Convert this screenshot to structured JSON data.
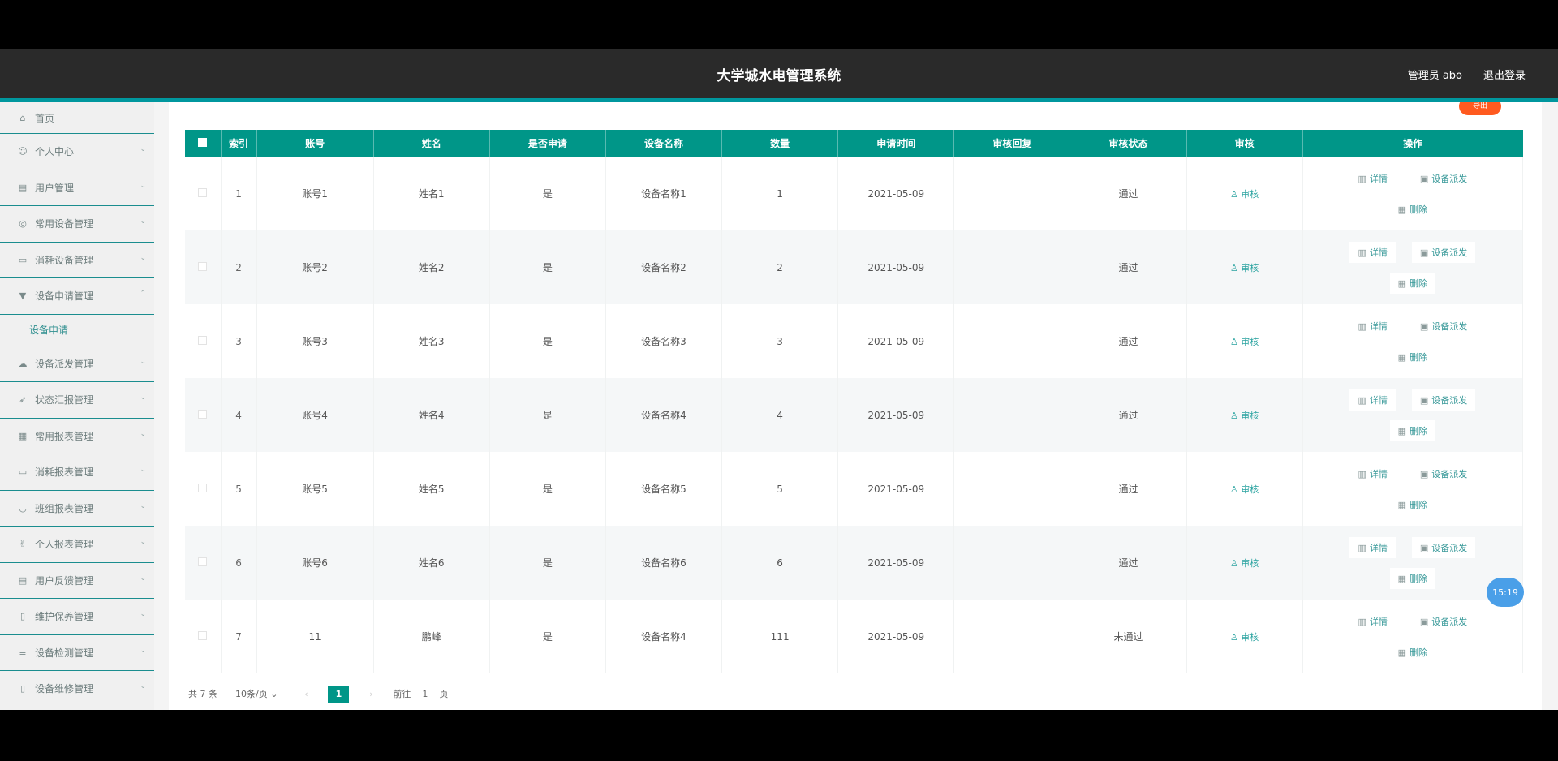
{
  "header": {
    "title": "大学城水电管理系统",
    "user": "管理员 abo",
    "logout": "退出登录"
  },
  "sidebar": {
    "items": [
      {
        "label": "首页",
        "icon": "home-icon"
      },
      {
        "label": "个人中心",
        "icon": "user-icon"
      },
      {
        "label": "用户管理",
        "icon": "users-icon"
      },
      {
        "label": "常用设备管理",
        "icon": "device-icon"
      },
      {
        "label": "消耗设备管理",
        "icon": "consumable-icon"
      },
      {
        "label": "设备申请管理",
        "icon": "apply-icon",
        "submenu": "设备申请"
      },
      {
        "label": "设备派发管理",
        "icon": "dispatch-icon"
      },
      {
        "label": "状态汇报管理",
        "icon": "report-icon"
      },
      {
        "label": "常用报表管理",
        "icon": "table-icon"
      },
      {
        "label": "消耗报表管理",
        "icon": "chat-icon"
      },
      {
        "label": "班组报表管理",
        "icon": "team-icon"
      },
      {
        "label": "个人报表管理",
        "icon": "person-icon"
      },
      {
        "label": "用户反馈管理",
        "icon": "feedback-icon"
      },
      {
        "label": "维护保养管理",
        "icon": "maintain-icon"
      },
      {
        "label": "设备检测管理",
        "icon": "list-icon"
      },
      {
        "label": "设备维修管理",
        "icon": "repair-icon"
      }
    ]
  },
  "table": {
    "headers": [
      "索引",
      "账号",
      "姓名",
      "是否申请",
      "设备名称",
      "数量",
      "申请时间",
      "审核回复",
      "审核状态",
      "审核",
      "操作"
    ],
    "rows": [
      {
        "idx": "1",
        "account": "账号1",
        "name": "姓名1",
        "applied": "是",
        "device": "设备名称1",
        "qty": "1",
        "time": "2021-05-09",
        "reply": "",
        "status": "通过",
        "audit": "审核"
      },
      {
        "idx": "2",
        "account": "账号2",
        "name": "姓名2",
        "applied": "是",
        "device": "设备名称2",
        "qty": "2",
        "time": "2021-05-09",
        "reply": "",
        "status": "通过",
        "audit": "审核"
      },
      {
        "idx": "3",
        "account": "账号3",
        "name": "姓名3",
        "applied": "是",
        "device": "设备名称3",
        "qty": "3",
        "time": "2021-05-09",
        "reply": "",
        "status": "通过",
        "audit": "审核"
      },
      {
        "idx": "4",
        "account": "账号4",
        "name": "姓名4",
        "applied": "是",
        "device": "设备名称4",
        "qty": "4",
        "time": "2021-05-09",
        "reply": "",
        "status": "通过",
        "audit": "审核"
      },
      {
        "idx": "5",
        "account": "账号5",
        "name": "姓名5",
        "applied": "是",
        "device": "设备名称5",
        "qty": "5",
        "time": "2021-05-09",
        "reply": "",
        "status": "通过",
        "audit": "审核"
      },
      {
        "idx": "6",
        "account": "账号6",
        "name": "姓名6",
        "applied": "是",
        "device": "设备名称6",
        "qty": "6",
        "time": "2021-05-09",
        "reply": "",
        "status": "通过",
        "audit": "审核"
      },
      {
        "idx": "7",
        "account": "11",
        "name": "鹏峰",
        "applied": "是",
        "device": "设备名称4",
        "qty": "111",
        "time": "2021-05-09",
        "reply": "",
        "status": "未通过",
        "audit": "审核"
      }
    ],
    "ops": {
      "detail": "详情",
      "dispatch": "设备派发",
      "delete": "删除"
    }
  },
  "pager": {
    "total": "共 7 条",
    "page_size": "10条/页",
    "current": "1",
    "goto_label": "前往",
    "goto_value": "1",
    "goto_suffix": "页"
  },
  "float_button": "导出",
  "clock": "15:19",
  "colors": {
    "accent": "#009688",
    "topbar": "#2a2a2a",
    "float": "#ff5a1f"
  }
}
